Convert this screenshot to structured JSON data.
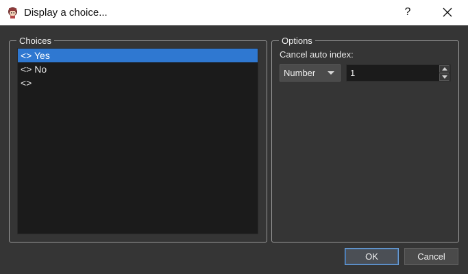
{
  "window": {
    "title": "Display a choice...",
    "help_label": "?",
    "icon": "app-character-icon"
  },
  "choices": {
    "group_title": "Choices",
    "items": [
      {
        "label": "<> Yes",
        "selected": true
      },
      {
        "label": "<> No",
        "selected": false
      },
      {
        "label": "<>",
        "selected": false
      }
    ]
  },
  "options": {
    "group_title": "Options",
    "cancel_label": "Cancel auto index:",
    "cancel_mode": "Number",
    "cancel_value": "1"
  },
  "buttons": {
    "ok_label": "OK",
    "cancel_label": "Cancel"
  },
  "colors": {
    "background": "#353535",
    "selection": "#2f78d1",
    "list_bg": "#1b1b1b"
  }
}
